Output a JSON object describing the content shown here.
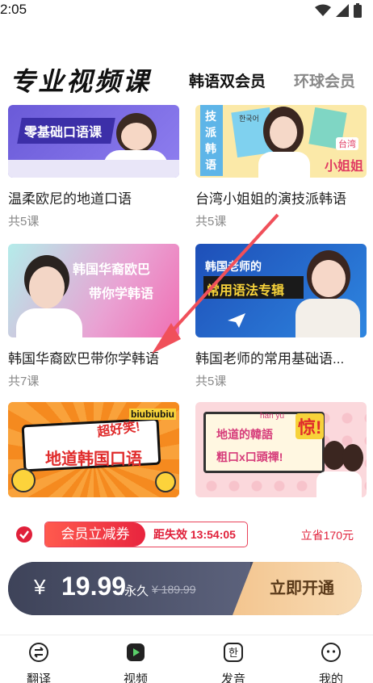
{
  "status": {
    "time": "2:05"
  },
  "header": {
    "title": "专业视频课",
    "tabs": [
      {
        "label": "韩语双会员",
        "active": true
      },
      {
        "label": "环球会员",
        "active": false
      }
    ]
  },
  "courses": [
    {
      "title": "温柔欧尼的地道口语",
      "count": "共5课",
      "thumb_text": "零基础口语课"
    },
    {
      "title": "台湾小姐姐的演技派韩语",
      "count": "共5课",
      "thumb_text": "技派韩语",
      "thumb_text2": "台湾",
      "thumb_text3": "小姐姐",
      "thumb_text4": "한국어"
    },
    {
      "title": "韩国华裔欧巴带你学韩语",
      "count": "共7课",
      "thumb_text": "韩国华裔欧巴",
      "thumb_text2": "带你学韩语"
    },
    {
      "title": "韩国老师的常用基础语...",
      "count": "共5课",
      "thumb_text": "韩国老师的",
      "thumb_text2": "常用语法专辑"
    },
    {
      "thumb_text": "超好笑!",
      "thumb_text2": "地道韩国口语",
      "thumb_text3": "biubiubiu"
    },
    {
      "thumb_text": "地道的韓語",
      "thumb_text2": "粗口x口頭禪!",
      "thumb_text3": "han yu",
      "thumb_text4": "惊!"
    }
  ],
  "coupon": {
    "label": "会员立减券",
    "expire": "距失效 13:54:05",
    "save": "立省170元"
  },
  "purchase": {
    "currency": "¥",
    "price": "19.99",
    "unit": "/永久",
    "original": "¥ 189.99",
    "button_label": "立即开通"
  },
  "nav": [
    {
      "label": "翻译",
      "icon": "translate-icon"
    },
    {
      "label": "视频",
      "icon": "video-icon"
    },
    {
      "label": "发音",
      "icon": "pronunciation-icon"
    },
    {
      "label": "我的",
      "icon": "profile-icon"
    }
  ],
  "colors": {
    "accent": "#e0203a",
    "dark": "#4a4f68",
    "gold": "#f3c58f"
  }
}
